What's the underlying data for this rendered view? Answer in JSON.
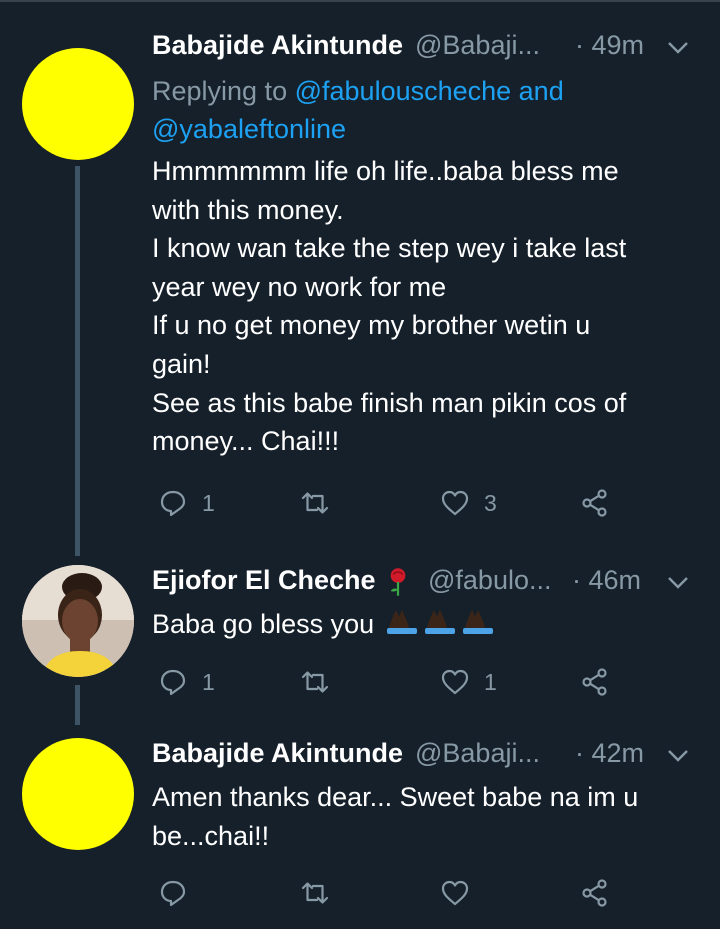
{
  "tweets": [
    {
      "name": "Babajide Akintunde",
      "handle": "@Babaji...",
      "time": "· 49m",
      "reply_prefix": "Replying to",
      "reply_to_1": "@fabulouscheche and",
      "reply_to_2": "@yabaleftonline",
      "lines": [
        "Hmmmmmm life oh life..baba bless me",
        "with this money.",
        "I know wan take the step wey i take last",
        "year wey no work for me",
        "If u no get money my brother wetin u",
        "gain!",
        "See as this babe finish man pikin cos of",
        "money... Chai!!!"
      ],
      "reply_count": "1",
      "like_count": "3"
    },
    {
      "name": "Ejiofor El Cheche",
      "name_emoji": "rose",
      "handle": "@fabulo...",
      "time": "· 46m",
      "text": "Baba go bless you",
      "text_emoji": "folded-hands x3",
      "reply_count": "1",
      "like_count": "1"
    },
    {
      "name": "Babajide Akintunde",
      "handle": "@Babaji...",
      "time": "· 42m",
      "lines": [
        "Amen thanks dear... Sweet babe na im u",
        "be...chai!!"
      ]
    }
  ],
  "icons": {
    "reply": "reply-icon",
    "retweet": "retweet-icon",
    "like": "heart-icon",
    "share": "share-icon",
    "more": "chevron-down-icon"
  },
  "colors": {
    "background": "#15202b",
    "secondary_text": "#8899a6",
    "link": "#1da1f2",
    "avatar_yellow": "#ffff00"
  }
}
